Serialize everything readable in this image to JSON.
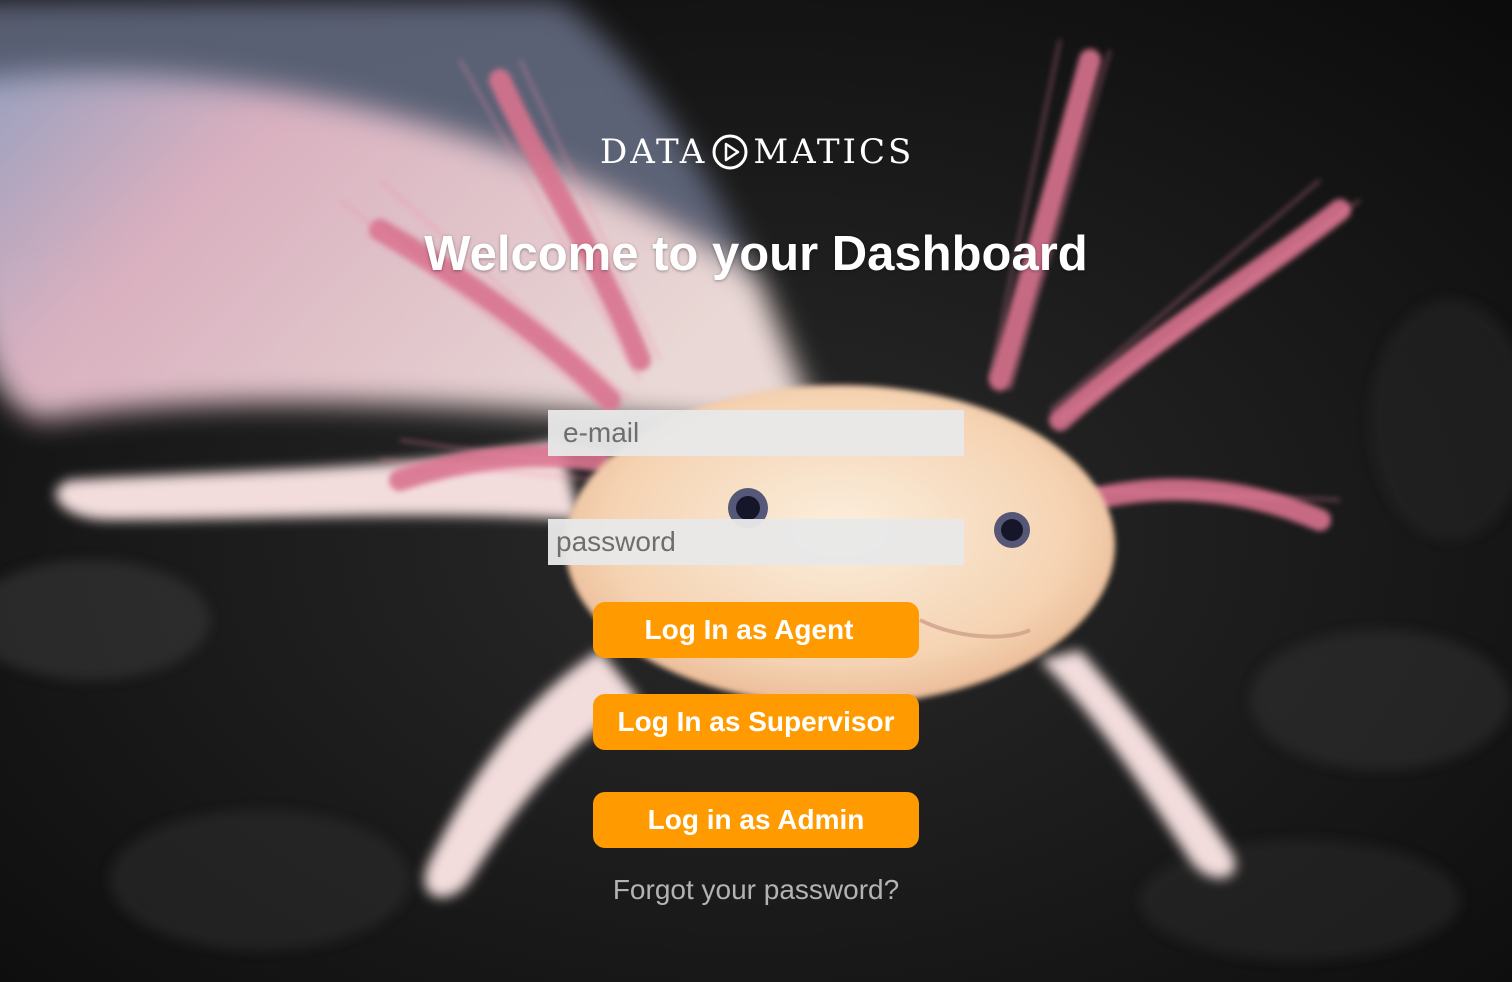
{
  "brand": {
    "logo_part1": "DATA",
    "logo_part2": "MATICS",
    "logo_icon": "play-circle-icon"
  },
  "page": {
    "headline": "Welcome to your Dashboard"
  },
  "form": {
    "email_placeholder": "e-mail",
    "email_value": "",
    "password_placeholder": "password",
    "password_value": ""
  },
  "buttons": {
    "agent_label": "Log In as Agent",
    "supervisor_label": "Log In as Supervisor",
    "admin_label": "Log in as Admin"
  },
  "links": {
    "forgot_password": "Forgot your password?"
  },
  "colors": {
    "button_bg": "#ff9a00",
    "button_text": "#ffffff",
    "headline": "#ffffff",
    "input_bg": "#e8e8e8",
    "link": "#b3b3b3"
  }
}
